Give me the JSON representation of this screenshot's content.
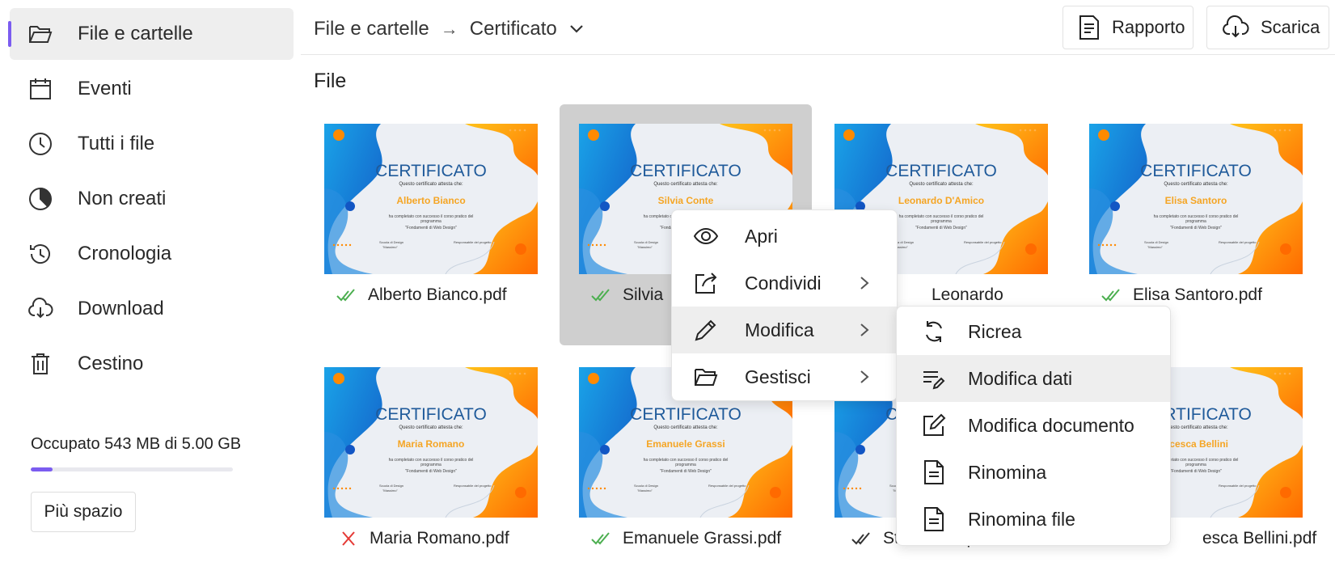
{
  "sidebar": {
    "items": [
      {
        "label": "File e cartelle",
        "icon": "folder-open-icon",
        "active": true
      },
      {
        "label": "Eventi",
        "icon": "calendar-icon"
      },
      {
        "label": "Tutti i file",
        "icon": "clock-icon"
      },
      {
        "label": "Non creati",
        "icon": "pie-chart-icon"
      },
      {
        "label": "Cronologia",
        "icon": "history-icon"
      },
      {
        "label": "Download",
        "icon": "cloud-download-icon"
      },
      {
        "label": "Cestino",
        "icon": "trash-icon"
      }
    ],
    "storage_text": "Occupato 543 MB di 5.00 GB",
    "storage_fraction": 0.1086,
    "more_button": "Più spazio"
  },
  "header": {
    "breadcrumb_root": "File e cartelle",
    "breadcrumb_separator": "→",
    "breadcrumb_current": "Certificato",
    "report_button": "Rapporto",
    "download_button": "Scarica"
  },
  "section_title": "File",
  "certificate": {
    "title": "CERTIFICATO",
    "subtitle": "Questo certificato attesta che:",
    "body_line1": "ha completato con successo il corso pratico del programma",
    "body_line2": "\"Fondamenti di Web Design\"",
    "sign_left_1": "Scuola di Design",
    "sign_left_2": "\"Massimo\"",
    "sign_right": "Responsabile del progetto"
  },
  "files": [
    {
      "cert_name": "Alberto Bianco",
      "file_label": "Alberto Bianco.pdf",
      "status": "ok"
    },
    {
      "cert_name": "Silvia Conte",
      "file_label": "Silvia",
      "status": "ok",
      "selected": true
    },
    {
      "cert_name": "Leonardo D'Amico",
      "file_label": "Leonardo",
      "status": "none"
    },
    {
      "cert_name": "Elisa Santoro",
      "file_label": "Elisa Santoro.pdf",
      "status": "ok"
    },
    {
      "cert_name": "Maria Romano",
      "file_label": "Maria Romano.pdf",
      "status": "error"
    },
    {
      "cert_name": "Emanuele Grassi",
      "file_label": "Emanuele Grassi.pdf",
      "status": "ok"
    },
    {
      "cert_name": "",
      "file_label": "Ste",
      "status": "sent",
      "trailing": "p"
    },
    {
      "cert_name": "ncesca Bellini",
      "file_label": "esca Bellini.pdf",
      "status": "none"
    }
  ],
  "context_menu": {
    "items": [
      {
        "label": "Apri",
        "icon": "eye-icon",
        "submenu": false
      },
      {
        "label": "Condividi",
        "icon": "share-icon",
        "submenu": true
      },
      {
        "label": "Modifica",
        "icon": "pencil-icon",
        "submenu": true,
        "highlighted": true
      },
      {
        "label": "Gestisci",
        "icon": "folder-open-icon",
        "submenu": true
      }
    ]
  },
  "submenu": {
    "items": [
      {
        "label": "Ricrea",
        "icon": "refresh-icon"
      },
      {
        "label": "Modifica dati",
        "icon": "edit-lines-icon",
        "highlighted": true
      },
      {
        "label": "Modifica documento",
        "icon": "edit-document-icon"
      },
      {
        "label": "Rinomina",
        "icon": "document-icon"
      },
      {
        "label": "Rinomina file",
        "icon": "document-icon"
      }
    ]
  },
  "colors": {
    "accent": "#7b5cf0",
    "ok_check": "#4caf50",
    "error_cross": "#e53935",
    "cert_title": "#1f5a9a",
    "cert_name": "#f5a524"
  }
}
